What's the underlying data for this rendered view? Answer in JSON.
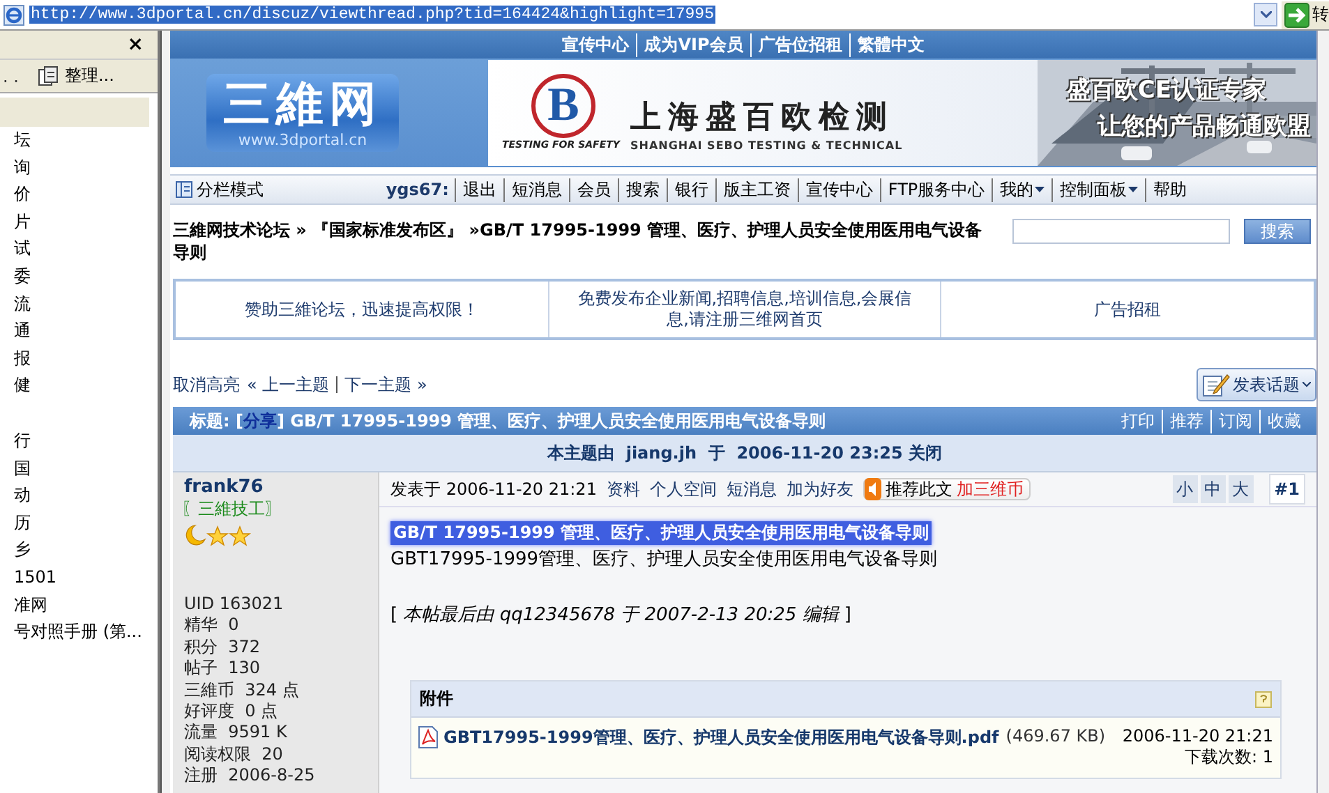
{
  "address_bar": {
    "url": "http://www.3dportal.cn/discuz/viewthread.php?tid=164424&highlight=17995",
    "go_label": "转"
  },
  "sidebar": {
    "close": "×",
    "cut_button": ". .",
    "organize_button": "整理...",
    "groups": [
      [
        "坛",
        "询",
        "价",
        "片",
        "试",
        "委",
        "流",
        "通",
        "报",
        "健"
      ],
      [
        "行",
        "国",
        "动",
        "历",
        "乡",
        "1501",
        "准网",
        "号对照手册 (第..."
      ]
    ]
  },
  "header_nav": [
    "宣传中心",
    "成为VIP会员",
    "广告位招租",
    "繁體中文"
  ],
  "logo": {
    "title": "三維网",
    "url": "www.3dportal.cn"
  },
  "ad": {
    "letter": "B",
    "tagline": "TESTING FOR SAFETY",
    "name": "上海盛百欧检测",
    "name_en": "SHANGHAI SEBO TESTING & TECHNICAL",
    "slogan_1": "盛百欧CE认证专家",
    "slogan_2": "让您的产品畅通欧盟"
  },
  "toolbar": {
    "mode": "分栏模式",
    "user": "ygs67:",
    "links": [
      {
        "label": "退出",
        "menu": false
      },
      {
        "label": "短消息",
        "menu": false
      },
      {
        "label": "会员",
        "menu": false
      },
      {
        "label": "搜索",
        "menu": false
      },
      {
        "label": "银行",
        "menu": false
      },
      {
        "label": "版主工资",
        "menu": false
      },
      {
        "label": "宣传中心",
        "menu": false
      },
      {
        "label": "FTP服务中心",
        "menu": false
      },
      {
        "label": "我的",
        "menu": true
      },
      {
        "label": "控制面板",
        "menu": true
      },
      {
        "label": "帮助",
        "menu": false
      }
    ]
  },
  "breadcrumb": "三維网技术论坛 » 『国家标准发布区』 »GB/T 17995-1999 管理、医疗、护理人员安全使用医用电气设备导则",
  "search": {
    "button": "搜索"
  },
  "promo_cells": [
    "赞助三維论坛，迅速提高权限！",
    "免费发布企业新闻,招聘信息,培训信息,会展信息,请注册三维网首页",
    "广告招租"
  ],
  "thread_nav": {
    "unhighlight": "取消高亮",
    "prev": "« 上一主题",
    "next": "下一主题 »",
    "new_topic": "发表话题"
  },
  "thread": {
    "prefix": "标题: [",
    "tag": "分享",
    "title": "] GB/T 17995-1999 管理、医疗、护理人员安全使用医用电气设备导则",
    "actions": [
      "打印",
      "推荐",
      "订阅",
      "收藏"
    ],
    "closed_notice": "本主题由  jiang.jh  于  2006-11-20 23:25 关闭"
  },
  "post": {
    "author": "frank76",
    "rank": "〖三維技工〗",
    "stats": [
      "UID 163021",
      "精华  0",
      "积分  372",
      "帖子  130",
      "三維币  324 点",
      "好评度  0 点",
      "流量  9591 K",
      "阅读权限  20",
      "注册  2006-8-25"
    ],
    "posted": "发表于 2006-11-20 21:21",
    "links": [
      "资料",
      "个人空间",
      "短消息",
      "加为好友"
    ],
    "recommend": "推荐此文",
    "recommend_bonus": "加三维币",
    "font_sizes": [
      "小",
      "中",
      "大"
    ],
    "floor": "#1",
    "highlight": "GB/T 17995-1999 管理、医疗、护理人员安全使用医用电气设备导则",
    "text": "GBT17995-1999管理、医疗、护理人员安全使用医用电气设备导则",
    "edit_note": "[ *本帖最后由 qq12345678 于 2007-2-13 20:25 编辑* ]",
    "attachment": {
      "heading": "附件",
      "file": "GBT17995-1999管理、医疗、护理人员安全使用医用电气设备导则.pdf",
      "size": "(469.67 KB)",
      "date": "2006-11-20 21:21",
      "downloads": "下载次数: 1"
    }
  }
}
